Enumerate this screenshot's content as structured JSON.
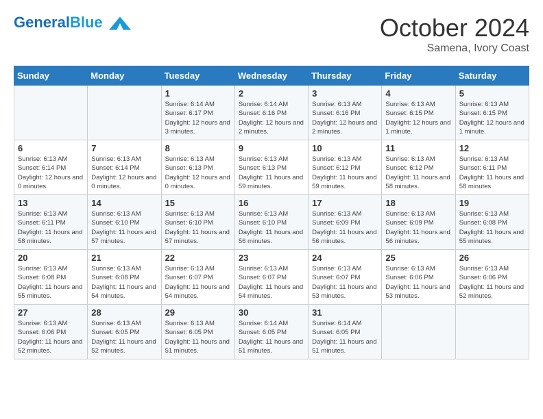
{
  "header": {
    "logo_general": "General",
    "logo_blue": "Blue",
    "month_title": "October 2024",
    "location": "Samena, Ivory Coast"
  },
  "weekdays": [
    "Sunday",
    "Monday",
    "Tuesday",
    "Wednesday",
    "Thursday",
    "Friday",
    "Saturday"
  ],
  "weeks": [
    [
      {
        "day": "",
        "sunrise": "",
        "sunset": "",
        "daylight": ""
      },
      {
        "day": "",
        "sunrise": "",
        "sunset": "",
        "daylight": ""
      },
      {
        "day": "1",
        "sunrise": "Sunrise: 6:14 AM",
        "sunset": "Sunset: 6:17 PM",
        "daylight": "Daylight: 12 hours and 3 minutes."
      },
      {
        "day": "2",
        "sunrise": "Sunrise: 6:14 AM",
        "sunset": "Sunset: 6:16 PM",
        "daylight": "Daylight: 12 hours and 2 minutes."
      },
      {
        "day": "3",
        "sunrise": "Sunrise: 6:13 AM",
        "sunset": "Sunset: 6:16 PM",
        "daylight": "Daylight: 12 hours and 2 minutes."
      },
      {
        "day": "4",
        "sunrise": "Sunrise: 6:13 AM",
        "sunset": "Sunset: 6:15 PM",
        "daylight": "Daylight: 12 hours and 1 minute."
      },
      {
        "day": "5",
        "sunrise": "Sunrise: 6:13 AM",
        "sunset": "Sunset: 6:15 PM",
        "daylight": "Daylight: 12 hours and 1 minute."
      }
    ],
    [
      {
        "day": "6",
        "sunrise": "Sunrise: 6:13 AM",
        "sunset": "Sunset: 6:14 PM",
        "daylight": "Daylight: 12 hours and 0 minutes."
      },
      {
        "day": "7",
        "sunrise": "Sunrise: 6:13 AM",
        "sunset": "Sunset: 6:14 PM",
        "daylight": "Daylight: 12 hours and 0 minutes."
      },
      {
        "day": "8",
        "sunrise": "Sunrise: 6:13 AM",
        "sunset": "Sunset: 6:13 PM",
        "daylight": "Daylight: 12 hours and 0 minutes."
      },
      {
        "day": "9",
        "sunrise": "Sunrise: 6:13 AM",
        "sunset": "Sunset: 6:13 PM",
        "daylight": "Daylight: 11 hours and 59 minutes."
      },
      {
        "day": "10",
        "sunrise": "Sunrise: 6:13 AM",
        "sunset": "Sunset: 6:12 PM",
        "daylight": "Daylight: 11 hours and 59 minutes."
      },
      {
        "day": "11",
        "sunrise": "Sunrise: 6:13 AM",
        "sunset": "Sunset: 6:12 PM",
        "daylight": "Daylight: 11 hours and 58 minutes."
      },
      {
        "day": "12",
        "sunrise": "Sunrise: 6:13 AM",
        "sunset": "Sunset: 6:11 PM",
        "daylight": "Daylight: 11 hours and 58 minutes."
      }
    ],
    [
      {
        "day": "13",
        "sunrise": "Sunrise: 6:13 AM",
        "sunset": "Sunset: 6:11 PM",
        "daylight": "Daylight: 11 hours and 58 minutes."
      },
      {
        "day": "14",
        "sunrise": "Sunrise: 6:13 AM",
        "sunset": "Sunset: 6:10 PM",
        "daylight": "Daylight: 11 hours and 57 minutes."
      },
      {
        "day": "15",
        "sunrise": "Sunrise: 6:13 AM",
        "sunset": "Sunset: 6:10 PM",
        "daylight": "Daylight: 11 hours and 57 minutes."
      },
      {
        "day": "16",
        "sunrise": "Sunrise: 6:13 AM",
        "sunset": "Sunset: 6:10 PM",
        "daylight": "Daylight: 11 hours and 56 minutes."
      },
      {
        "day": "17",
        "sunrise": "Sunrise: 6:13 AM",
        "sunset": "Sunset: 6:09 PM",
        "daylight": "Daylight: 11 hours and 56 minutes."
      },
      {
        "day": "18",
        "sunrise": "Sunrise: 6:13 AM",
        "sunset": "Sunset: 6:09 PM",
        "daylight": "Daylight: 11 hours and 56 minutes."
      },
      {
        "day": "19",
        "sunrise": "Sunrise: 6:13 AM",
        "sunset": "Sunset: 6:08 PM",
        "daylight": "Daylight: 11 hours and 55 minutes."
      }
    ],
    [
      {
        "day": "20",
        "sunrise": "Sunrise: 6:13 AM",
        "sunset": "Sunset: 6:08 PM",
        "daylight": "Daylight: 11 hours and 55 minutes."
      },
      {
        "day": "21",
        "sunrise": "Sunrise: 6:13 AM",
        "sunset": "Sunset: 6:08 PM",
        "daylight": "Daylight: 11 hours and 54 minutes."
      },
      {
        "day": "22",
        "sunrise": "Sunrise: 6:13 AM",
        "sunset": "Sunset: 6:07 PM",
        "daylight": "Daylight: 11 hours and 54 minutes."
      },
      {
        "day": "23",
        "sunrise": "Sunrise: 6:13 AM",
        "sunset": "Sunset: 6:07 PM",
        "daylight": "Daylight: 11 hours and 54 minutes."
      },
      {
        "day": "24",
        "sunrise": "Sunrise: 6:13 AM",
        "sunset": "Sunset: 6:07 PM",
        "daylight": "Daylight: 11 hours and 53 minutes."
      },
      {
        "day": "25",
        "sunrise": "Sunrise: 6:13 AM",
        "sunset": "Sunset: 6:06 PM",
        "daylight": "Daylight: 11 hours and 53 minutes."
      },
      {
        "day": "26",
        "sunrise": "Sunrise: 6:13 AM",
        "sunset": "Sunset: 6:06 PM",
        "daylight": "Daylight: 11 hours and 52 minutes."
      }
    ],
    [
      {
        "day": "27",
        "sunrise": "Sunrise: 6:13 AM",
        "sunset": "Sunset: 6:06 PM",
        "daylight": "Daylight: 11 hours and 52 minutes."
      },
      {
        "day": "28",
        "sunrise": "Sunrise: 6:13 AM",
        "sunset": "Sunset: 6:05 PM",
        "daylight": "Daylight: 11 hours and 52 minutes."
      },
      {
        "day": "29",
        "sunrise": "Sunrise: 6:13 AM",
        "sunset": "Sunset: 6:05 PM",
        "daylight": "Daylight: 11 hours and 51 minutes."
      },
      {
        "day": "30",
        "sunrise": "Sunrise: 6:14 AM",
        "sunset": "Sunset: 6:05 PM",
        "daylight": "Daylight: 11 hours and 51 minutes."
      },
      {
        "day": "31",
        "sunrise": "Sunrise: 6:14 AM",
        "sunset": "Sunset: 6:05 PM",
        "daylight": "Daylight: 11 hours and 51 minutes."
      },
      {
        "day": "",
        "sunrise": "",
        "sunset": "",
        "daylight": ""
      },
      {
        "day": "",
        "sunrise": "",
        "sunset": "",
        "daylight": ""
      }
    ]
  ]
}
